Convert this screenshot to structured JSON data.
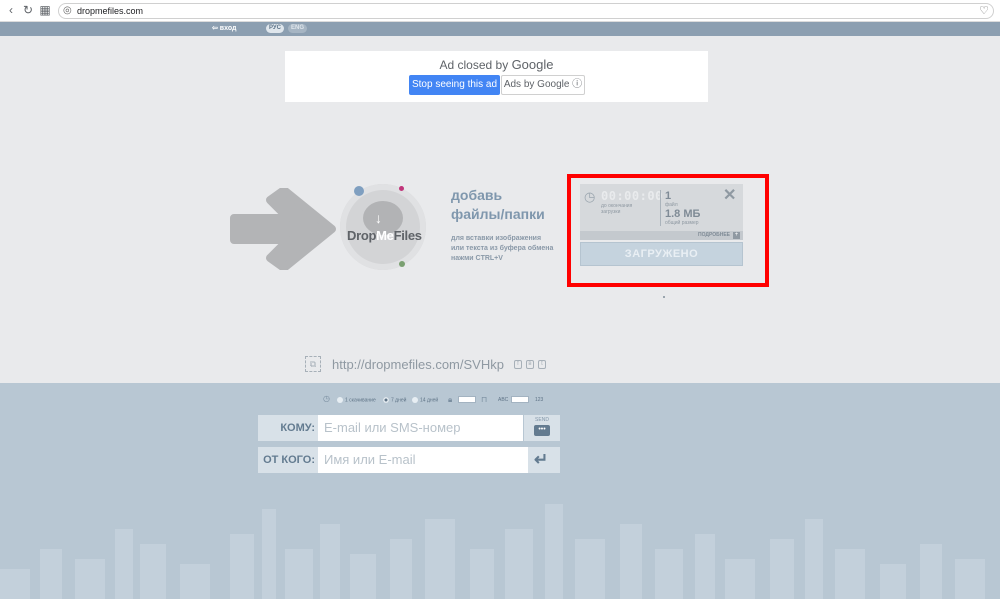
{
  "browser": {
    "url": "dropmefiles.com",
    "back_icon": "chevron-left-icon",
    "reload_icon": "reload-icon",
    "apps_icon": "grid-icon",
    "site_icon": "globe-icon",
    "bookmark_icon": "heart-icon"
  },
  "topbar": {
    "login_label": "⇦ вход",
    "lang_rus": "РУС",
    "lang_eng": "ENG"
  },
  "ad": {
    "closed_text": "Ad closed by",
    "google": "Google",
    "stop_button": "Stop seeing this ad",
    "ads_by_button": "Ads by Google ⓘ"
  },
  "dropzone": {
    "logo_drop": "Drop",
    "logo_me": "Me",
    "logo_files": "Files",
    "title_line1": "добавь",
    "title_line2": "файлы/папки",
    "hint_line1": "для вставки изображения",
    "hint_line2": "или текста из буфера обмена",
    "hint_line3": "нажми CTRL+V"
  },
  "upload_panel": {
    "timer": "00:00:00",
    "timer_label_1": "до окончания",
    "timer_label_2": "загрузки",
    "files_count": "1",
    "files_label": "файл",
    "total_size": "1.8 МБ",
    "total_size_label": "общий размер",
    "details_label": "ПОДРОБНЕЕ",
    "status_button": "ЗАГРУЖЕНО"
  },
  "share": {
    "link": "http://dropmefiles.com/SVHkp"
  },
  "options": {
    "opt1": "1 скачивание",
    "opt2": "7 дней",
    "opt3": "14 дней",
    "abc_label": "ABC",
    "digits_label": "123"
  },
  "form": {
    "to_label": "КОМУ:",
    "to_placeholder": "E-mail или SMS-номер",
    "send_label": "SEND",
    "from_label": "ОТ КОГО:",
    "from_placeholder": "Имя или E-mail"
  },
  "colors": {
    "highlight": "#ff0000",
    "accent_blue": "#4285f4",
    "dot_blue": "#7f9fc0",
    "dot_pink": "#c0357a",
    "dot_green": "#7aa071"
  }
}
